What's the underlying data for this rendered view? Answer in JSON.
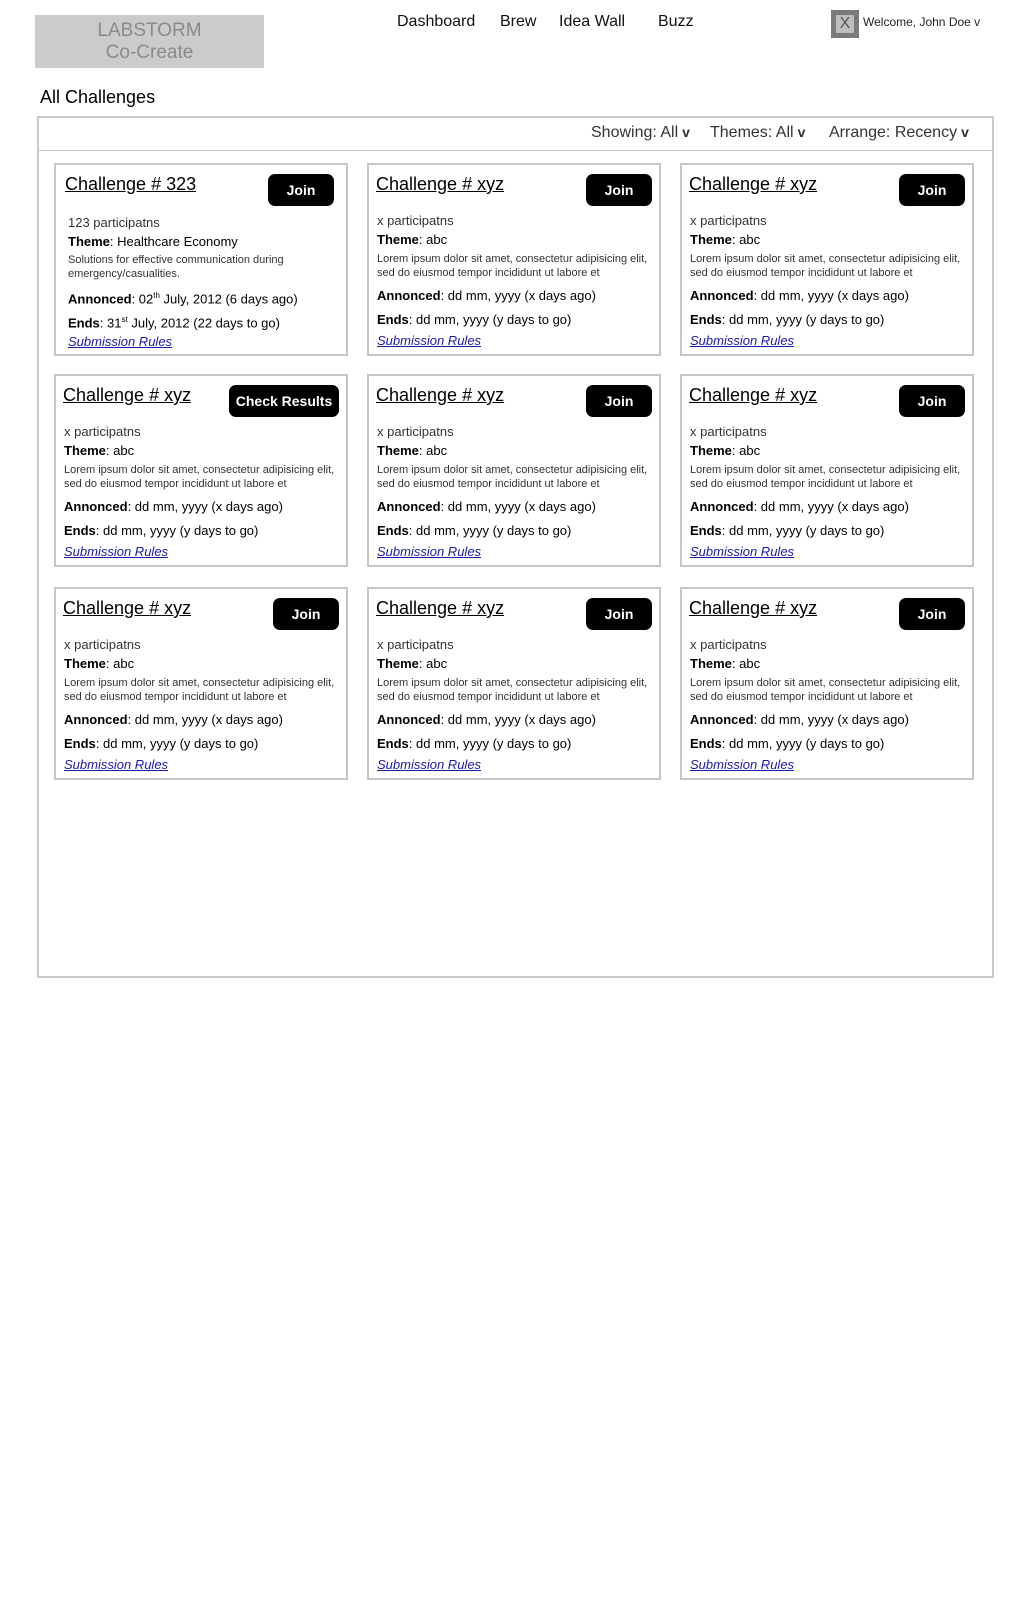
{
  "header": {
    "logo_line1": "LABSTORM",
    "logo_line2": "Co-Create",
    "nav": [
      "Dashboard",
      "Brew",
      "Idea Wall",
      "Buzz"
    ],
    "avatar_glyph": "X",
    "welcome": "Welcome, John Doe v"
  },
  "page_title": "All Challenges",
  "filters": {
    "showing": "Showing: All",
    "themes": "Themes: All",
    "arrange": "Arrange: Recency",
    "caret": "v"
  },
  "labels": {
    "theme": "Theme",
    "announced": "Annonced",
    "ends": "Ends",
    "rules": "Submission Rules"
  },
  "challenges": [
    {
      "title": "Challenge # 323",
      "button": "Join",
      "participants": "123 participatns",
      "theme": "Healthcare Economy",
      "description": "Solutions for effective communication during emergency/casualities.",
      "announced_day": "02",
      "announced_sup": "th",
      "announced_rest": " July, 2012 (6 days ago)",
      "ends_day": "31",
      "ends_sup": "st",
      "ends_rest": " July, 2012 (22 days to go)"
    },
    {
      "title": "Challenge # xyz",
      "button": "Join",
      "participants": "x participatns",
      "theme": "abc",
      "description": "Lorem ipsum dolor sit amet, consectetur adipisicing elit, sed do eiusmod tempor incididunt ut labore et",
      "announced": "dd mm, yyyy (x days ago)",
      "ends": "dd  mm, yyyy (y days to go)"
    },
    {
      "title": "Challenge # xyz",
      "button": "Join",
      "participants": "x participatns",
      "theme": "abc",
      "description": "Lorem ipsum dolor sit amet, consectetur adipisicing elit, sed do eiusmod tempor incididunt ut labore et",
      "announced": "dd mm, yyyy (x days ago)",
      "ends": "dd  mm, yyyy (y days to go)"
    },
    {
      "title": "Challenge # xyz",
      "button": "Check Results",
      "participants": "x participatns",
      "theme": "abc",
      "description": "Lorem ipsum dolor sit amet, consectetur adipisicing elit, sed do eiusmod tempor incididunt ut labore et",
      "announced": "dd mm, yyyy (x days ago)",
      "ends": "dd  mm, yyyy (y days to go)"
    },
    {
      "title": "Challenge # xyz",
      "button": "Join",
      "participants": "x participatns",
      "theme": "abc",
      "description": "Lorem ipsum dolor sit amet, consectetur adipisicing elit, sed do eiusmod tempor incididunt ut labore et",
      "announced": "dd mm, yyyy (x days ago)",
      "ends": "dd  mm, yyyy (y days to go)"
    },
    {
      "title": "Challenge # xyz",
      "button": "Join",
      "participants": "x participatns",
      "theme": "abc",
      "description": "Lorem ipsum dolor sit amet, consectetur adipisicing elit, sed do eiusmod tempor incididunt ut labore et",
      "announced": "dd mm, yyyy (x days ago)",
      "ends": "dd  mm, yyyy (y days to go)"
    },
    {
      "title": "Challenge # xyz",
      "button": "Join",
      "participants": "x participatns",
      "theme": "abc",
      "description": "Lorem ipsum dolor sit amet, consectetur adipisicing elit, sed do eiusmod tempor incididunt ut labore et",
      "announced": "dd mm, yyyy (x days ago)",
      "ends": "dd  mm, yyyy (y days to go)"
    },
    {
      "title": "Challenge # xyz",
      "button": "Join",
      "participants": "x participatns",
      "theme": "abc",
      "description": "Lorem ipsum dolor sit amet, consectetur adipisicing elit, sed do eiusmod tempor incididunt ut labore et",
      "announced": "dd mm, yyyy (x days ago)",
      "ends": "dd  mm, yyyy (y days to go)"
    },
    {
      "title": "Challenge # xyz",
      "button": "Join",
      "participants": "x participatns",
      "theme": "abc",
      "description": "Lorem ipsum dolor sit amet, consectetur adipisicing elit, sed do eiusmod tempor incididunt ut labore et",
      "announced": "dd mm, yyyy (x days ago)",
      "ends": "dd  mm, yyyy (y days to go)"
    }
  ]
}
